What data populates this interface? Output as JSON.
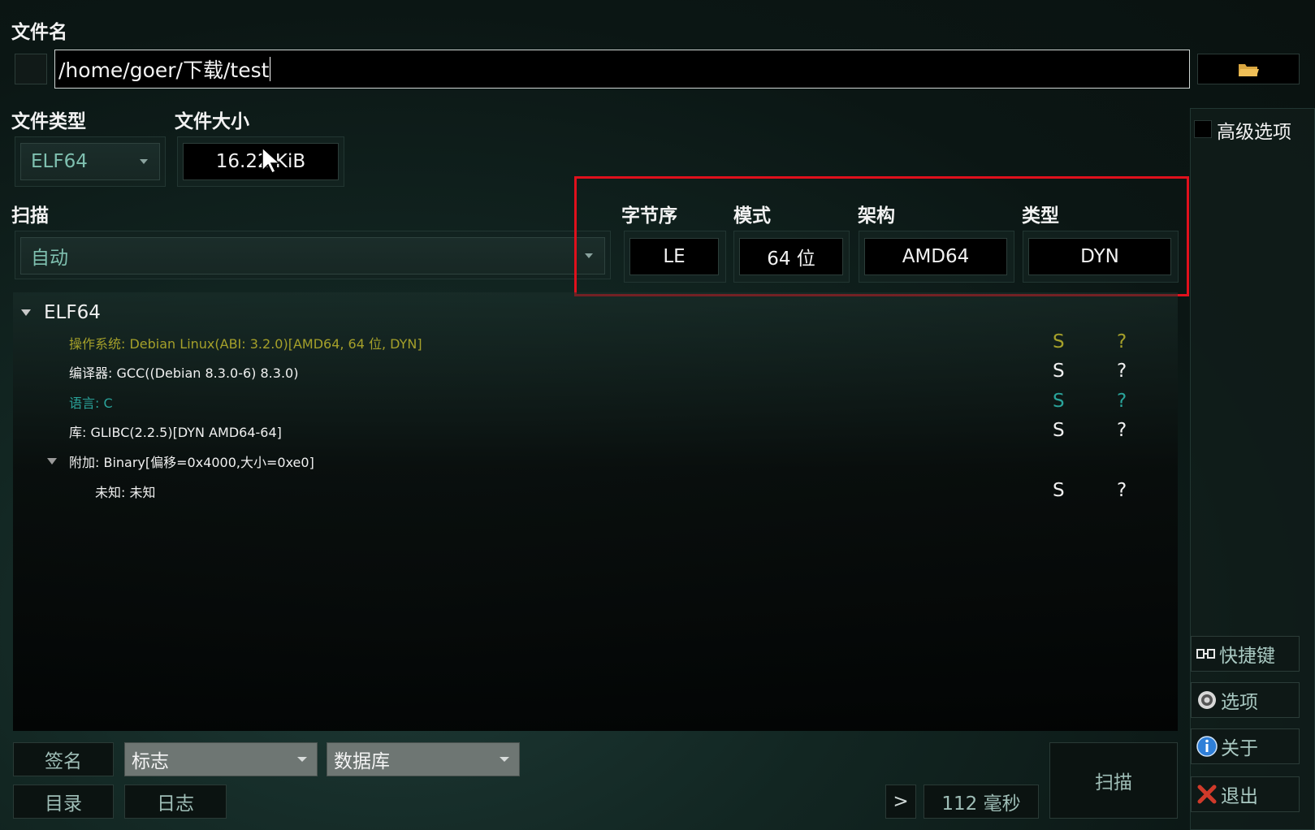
{
  "file": {
    "label": "文件名",
    "path": "/home/goer/下载/test"
  },
  "file_type": {
    "label": "文件类型",
    "value": "ELF64"
  },
  "file_size": {
    "label": "文件大小",
    "value": "16.22 KiB"
  },
  "advanced": {
    "label": "高级选项",
    "checked": false
  },
  "scan": {
    "label": "扫描",
    "mode": "自动"
  },
  "info": [
    {
      "label": "字节序",
      "value": "LE"
    },
    {
      "label": "模式",
      "value": "64 位"
    },
    {
      "label": "架构",
      "value": "AMD64"
    },
    {
      "label": "类型",
      "value": "DYN"
    }
  ],
  "tree": {
    "root": "ELF64",
    "items": [
      {
        "text": "操作系统: Debian Linux(ABI: 3.2.0)[AMD64, 64 位, DYN]",
        "s": "S",
        "q": "?",
        "color": "#a5a02a"
      },
      {
        "text": "编译器: GCC((Debian 8.3.0-6) 8.3.0)",
        "s": "S",
        "q": "?",
        "color": "#f0f0f0"
      },
      {
        "text": "语言: C",
        "s": "S",
        "q": "?",
        "color": "#2aa39a"
      },
      {
        "text": "库: GLIBC(2.2.5)[DYN AMD64-64]",
        "s": "S",
        "q": "?",
        "color": "#f0f0f0"
      }
    ],
    "overlay": {
      "text": "附加: Binary[偏移=0x4000,大小=0xe0]"
    },
    "overlay_child": {
      "text": "未知: 未知",
      "s": "S",
      "q": "?"
    }
  },
  "side": {
    "shortcuts": "快捷键",
    "options": "选项",
    "about": "关于",
    "exit": "退出"
  },
  "bottom": {
    "signature": "签名",
    "flags": "标志",
    "database": "数据库",
    "directory": "目录",
    "log": "日志",
    "next": ">",
    "time": "112 毫秒",
    "scan_button": "扫描"
  },
  "colors": {
    "highlight_box": "#e0101c",
    "os_text": "#a5a02a",
    "lang_text": "#2aa39a"
  }
}
